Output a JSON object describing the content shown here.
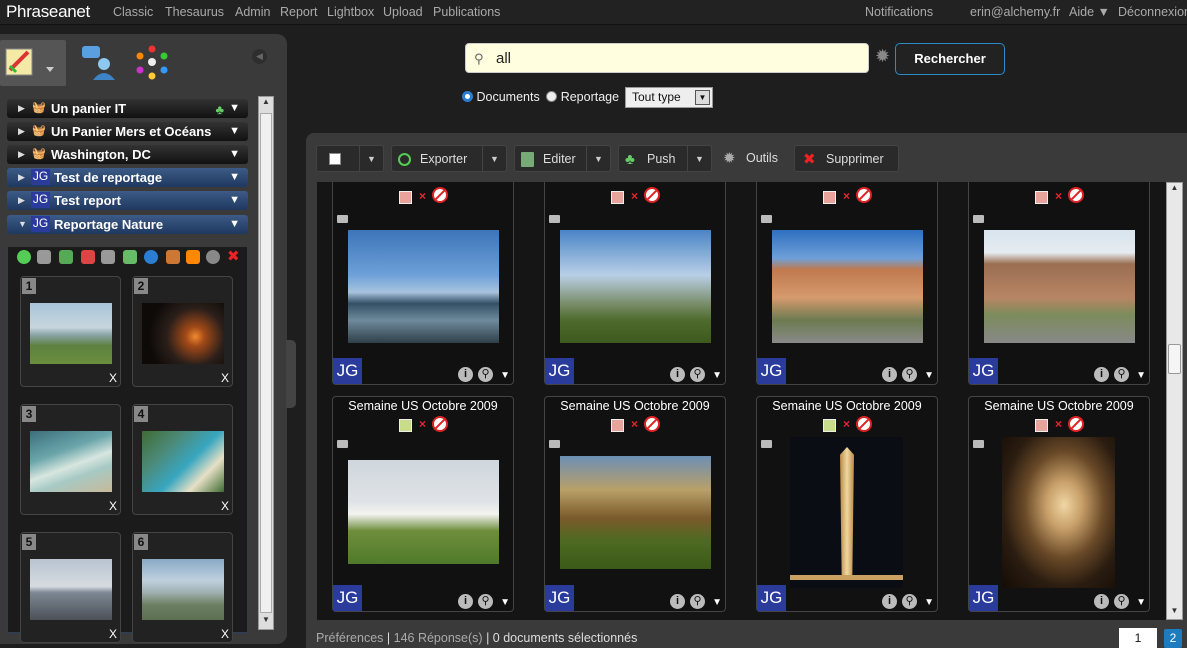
{
  "topbar": {
    "logo": "Phraseanet",
    "nav": [
      "Classic",
      "Thesaurus",
      "Admin",
      "Report",
      "Lightbox",
      "Upload",
      "Publications"
    ],
    "notifications": "Notifications",
    "user": "erin@alchemy.fr",
    "help": "Aide ▼",
    "logout": "Déconnexion"
  },
  "sidebar": {
    "baskets": [
      {
        "name": "Un panier IT",
        "type": "basket"
      },
      {
        "name": "Un Panier Mers et Océans",
        "type": "basket"
      },
      {
        "name": "Washington, DC",
        "type": "basket"
      },
      {
        "name": "Test de reportage",
        "type": "story",
        "badge": "JG"
      },
      {
        "name": "Test report",
        "type": "story",
        "badge": "JG"
      },
      {
        "name": "Reportage Nature",
        "type": "story",
        "badge": "JG",
        "expanded": true
      }
    ],
    "items": [
      {
        "num": "1",
        "remove": "X"
      },
      {
        "num": "2",
        "remove": "X"
      },
      {
        "num": "3",
        "remove": "X"
      },
      {
        "num": "4",
        "remove": "X"
      },
      {
        "num": "5",
        "remove": "X"
      },
      {
        "num": "6",
        "remove": "X"
      }
    ]
  },
  "search": {
    "value": "all",
    "button": "Rechercher",
    "opt_documents": "Documents",
    "opt_reportage": "Reportage",
    "type_select": "Tout type"
  },
  "toolbar": {
    "export": "Exporter",
    "edit": "Editer",
    "push": "Push",
    "tools": "Outils",
    "delete": "Supprimer"
  },
  "results": {
    "badge": "JG",
    "cards": [
      {
        "title": "",
        "status_color": "#e8a39a"
      },
      {
        "title": "",
        "status_color": "#e8a39a"
      },
      {
        "title": "",
        "status_color": "#e8a39a"
      },
      {
        "title": "",
        "status_color": "#e8a39a"
      },
      {
        "title": "Semaine US Octobre 2009",
        "status_color": "#c9dc8a"
      },
      {
        "title": "Semaine US Octobre 2009",
        "status_color": "#e8a39a"
      },
      {
        "title": "Semaine US Octobre 2009",
        "status_color": "#c9dc8a"
      },
      {
        "title": "Semaine US Octobre 2009",
        "status_color": "#e8a39a"
      }
    ]
  },
  "status": {
    "prefs": "Préférences",
    "answers": "146 Réponse(s)",
    "selected": "0 documents sélectionnés"
  },
  "pagination": {
    "current": "1",
    "next": "2"
  }
}
